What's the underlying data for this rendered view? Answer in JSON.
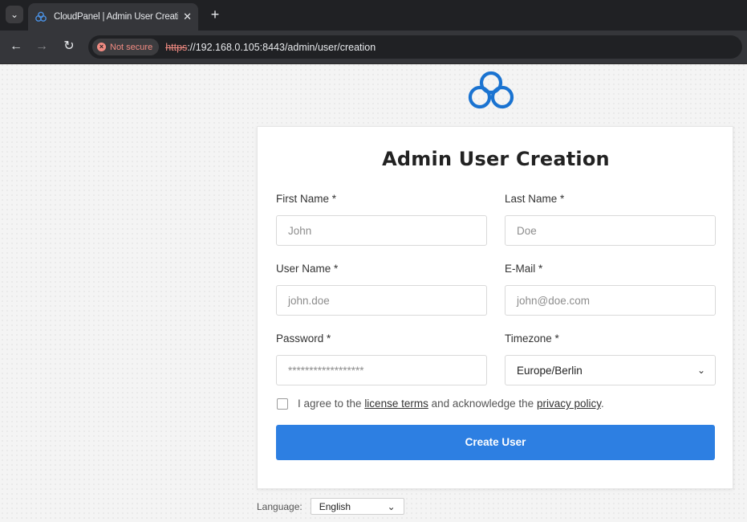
{
  "browser": {
    "tab_title": "CloudPanel | Admin User Creation",
    "tab_close": "✕",
    "new_tab": "+",
    "security_label": "Not secure",
    "url_scheme": "https",
    "url_rest": "://192.168.0.105:8443/admin/user/creation"
  },
  "page": {
    "title": "Admin User Creation",
    "fields": {
      "first_name": {
        "label": "First Name *",
        "placeholder": "John"
      },
      "last_name": {
        "label": "Last Name *",
        "placeholder": "Doe"
      },
      "user_name": {
        "label": "User Name *",
        "placeholder": "john.doe"
      },
      "email": {
        "label": "E-Mail *",
        "placeholder": "john@doe.com"
      },
      "password": {
        "label": "Password *",
        "placeholder": "******************"
      },
      "timezone": {
        "label": "Timezone *",
        "value": "Europe/Berlin"
      }
    },
    "agree": {
      "prefix": "I agree to the ",
      "license_link": "license terms",
      "middle": " and acknowledge the ",
      "privacy_link": "privacy policy",
      "suffix": "."
    },
    "submit_label": "Create User",
    "language": {
      "label": "Language:",
      "value": "English"
    }
  },
  "colors": {
    "accent": "#2d7fe2",
    "logo": "#1a73d1"
  }
}
